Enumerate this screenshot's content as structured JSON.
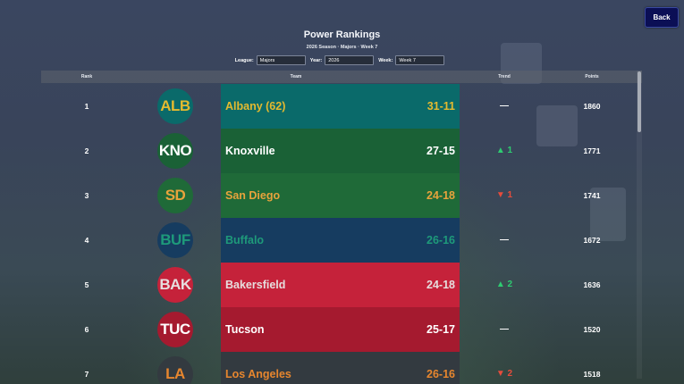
{
  "nav": {
    "back_label": "Back"
  },
  "header": {
    "title": "Power Rankings",
    "subtitle": "2026 Season · Majors · Week 7"
  },
  "filters": {
    "league_label": "League:",
    "league_value": "Majors",
    "year_label": "Year:",
    "year_value": "2026",
    "week_label": "Week:",
    "week_value": "Week 7"
  },
  "table": {
    "columns": {
      "rank": "Rank",
      "team": "Team",
      "trend": "Trend",
      "points": "Points"
    },
    "rows": [
      {
        "rank": "1",
        "abbr": "ALB",
        "name": "Albany (62)",
        "record": "31-11",
        "trend": "—",
        "trend_dir": "flat",
        "points": "1860",
        "bg": "#0a6a6a",
        "fg": "#e4ba2f",
        "logo_bg": "#0a6a6a"
      },
      {
        "rank": "2",
        "abbr": "KNO",
        "name": "Knoxville",
        "record": "27-15",
        "trend": "▲ 1",
        "trend_dir": "up",
        "points": "1771",
        "bg": "#1a6136",
        "fg": "#ffffff",
        "logo_bg": "#1a6136"
      },
      {
        "rank": "3",
        "abbr": "SD",
        "name": "San Diego",
        "record": "24-18",
        "trend": "▼ 1",
        "trend_dir": "down",
        "points": "1741",
        "bg": "#1f6a38",
        "fg": "#e8a33c",
        "logo_bg": "#1f6a38"
      },
      {
        "rank": "4",
        "abbr": "BUF",
        "name": "Buffalo",
        "record": "26-16",
        "trend": "—",
        "trend_dir": "flat",
        "points": "1672",
        "bg": "#163c60",
        "fg": "#1e9a7a",
        "logo_bg": "#163c60"
      },
      {
        "rank": "5",
        "abbr": "BAK",
        "name": "Bakersfield",
        "record": "24-18",
        "trend": "▲ 2",
        "trend_dir": "up",
        "points": "1636",
        "bg": "#c5223a",
        "fg": "#e6dede",
        "logo_bg": "#c5223a"
      },
      {
        "rank": "6",
        "abbr": "TUC",
        "name": "Tucson",
        "record": "25-17",
        "trend": "—",
        "trend_dir": "flat",
        "points": "1520",
        "bg": "#a51a2f",
        "fg": "#ffffff",
        "logo_bg": "#a51a2f"
      },
      {
        "rank": "7",
        "abbr": "LA",
        "name": "Los Angeles",
        "record": "26-16",
        "trend": "▼ 2",
        "trend_dir": "down",
        "points": "1518",
        "bg": "#333a40",
        "fg": "#e7862e",
        "logo_bg": "#333a40"
      }
    ]
  },
  "colors": {
    "trend_up": "#2ecc71",
    "trend_down": "#e74c3c",
    "trend_flat": "#ffffff",
    "back_bg": "#0b0f55"
  }
}
